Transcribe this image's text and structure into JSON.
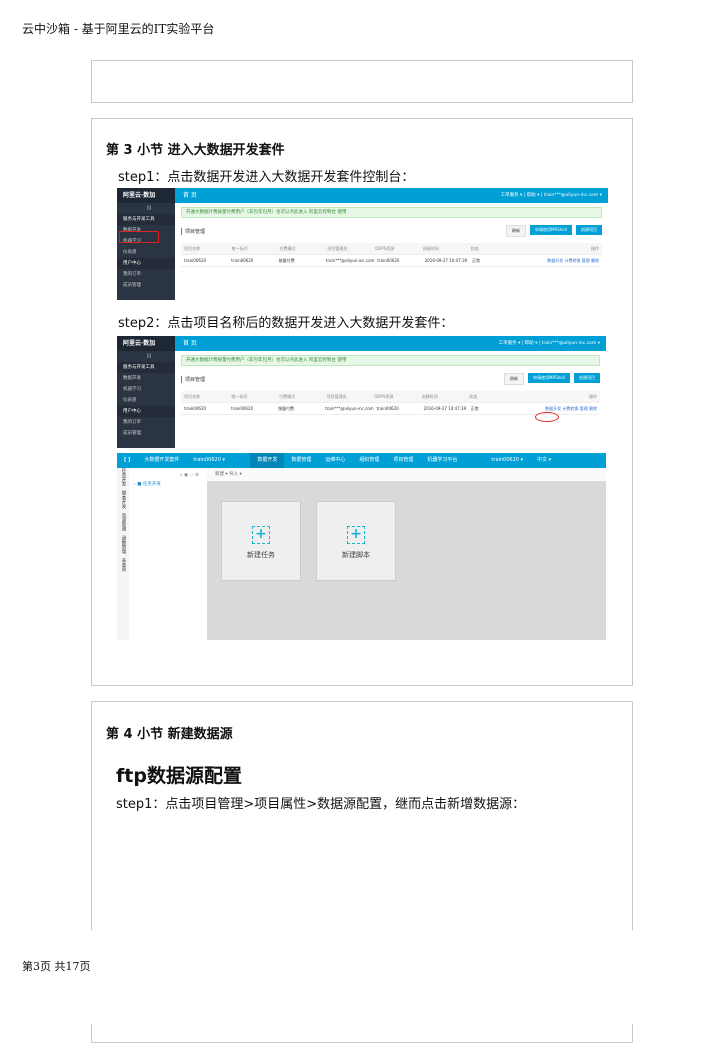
{
  "header": "云中沙箱 - 基于阿里云的IT实验平台",
  "footer": "第3页 共17页",
  "section3": {
    "title": "第 3 小节 进入大数据开发套件",
    "step1": "step1：点击数据开发进入大数据开发套件控制台：",
    "step2": "step2：点击项目名称后的数据开发进入大数据开发套件："
  },
  "console": {
    "logo": "阿里云·数加",
    "page_title": "首 页",
    "top_right": "工单服务 ▾ | 帮助 ▾ | train***@aliyun-inc.com ▾",
    "sidebar": [
      "服务与开发工具",
      "数据开发",
      "机器学习",
      "仪表盘",
      "用户中心",
      "我的订单",
      "成员管理"
    ],
    "notice": "开通大数据计费按量付费用户（非包年包月）也可以点此进入 阿里云控制台 使用",
    "section": "项目管理",
    "buttons": [
      "刷新",
      "申请使用MRShell",
      "创建项目"
    ],
    "columns": [
      "项目名称",
      "唯一标识",
      "付费模式",
      "项目管理员",
      "ODPS资源",
      "创建时间",
      "状态",
      "操作"
    ],
    "row": [
      "train00620",
      "train00620",
      "按量付费",
      "train***@aliyun-inc.com",
      "train00620",
      "2016-09-27 10:47:39",
      "正常",
      "数据开发  计费转换  管理  删除"
    ]
  },
  "ide": {
    "nav": [
      "大数据开发套件",
      "train00620 ▾",
      "数据开发",
      "数据管理",
      "运维中心",
      "组织管理",
      "项目管理",
      "机器学习平台",
      "train00620 ▾",
      "中文 ▾"
    ],
    "side_tabs": [
      "任务开发",
      "脚本开发",
      "资源管理",
      "函数管理",
      "表查询"
    ],
    "tree": "› ■ 任务开发",
    "toolbar": "新建 ▾    导入 ▾",
    "cards": [
      "新建任务",
      "新建脚本"
    ]
  },
  "section4": {
    "title": "第 4 小节 新建数据源",
    "subtitle": "ftp数据源配置",
    "step1": "step1：点击项目管理>项目属性>数据源配置，继而点击新增数据源："
  }
}
